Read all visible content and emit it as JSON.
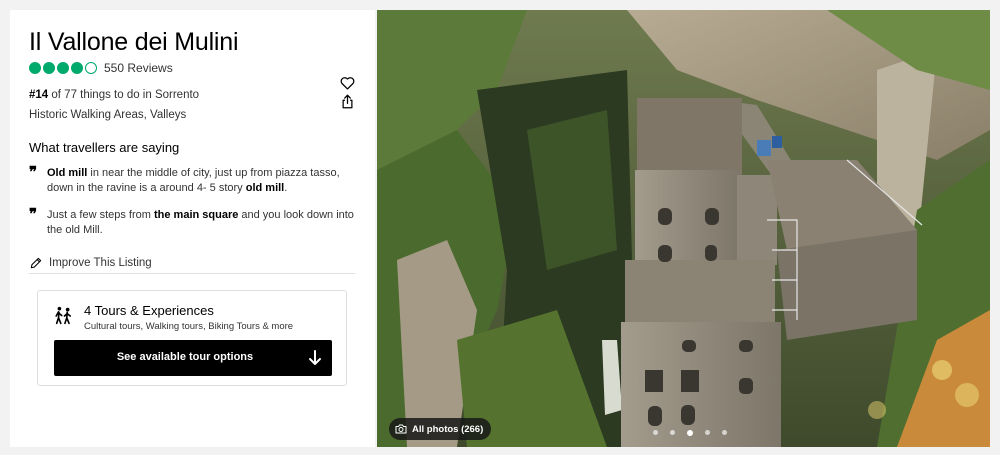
{
  "attraction": {
    "title": "Il Vallone dei Mulini",
    "rating": 4,
    "rating_max": 5,
    "reviews": "550 Reviews",
    "rank_number": "#14",
    "rank_text": " of 77 things to do in Sorrento",
    "category": "Historic Walking Areas, Valleys"
  },
  "icons": {
    "save": "heart-icon",
    "share": "share-icon",
    "improve": "pencil-icon",
    "tours": "walking-people-icon",
    "tour_button": "arrow-down-icon",
    "photos": "camera-icon"
  },
  "reviews_section": {
    "title": "What travellers are saying",
    "quotes": [
      {
        "p1_bold": "Old mill",
        "p2": " in near the middle of city, just up from piazza tasso, down in the ravine is a around 4- 5 story ",
        "p3_bold": "old mill",
        "p4": "."
      },
      {
        "p1": "Just a few steps from ",
        "p2_bold": "the main square",
        "p3": " and you look down into the old Mill."
      }
    ]
  },
  "improve_listing": "Improve This Listing",
  "tours": {
    "title": "4 Tours & Experiences",
    "subtitle": "Cultural tours, Walking tours, Biking Tours & more",
    "button_label": "See available tour options"
  },
  "photo": {
    "all_photos_label": "All photos (266)",
    "dot_count": 5,
    "active_dot": 2
  },
  "colors": {
    "rating_green": "#00aa6c",
    "button_black": "#000000",
    "page_bg": "#f2f2f2"
  }
}
